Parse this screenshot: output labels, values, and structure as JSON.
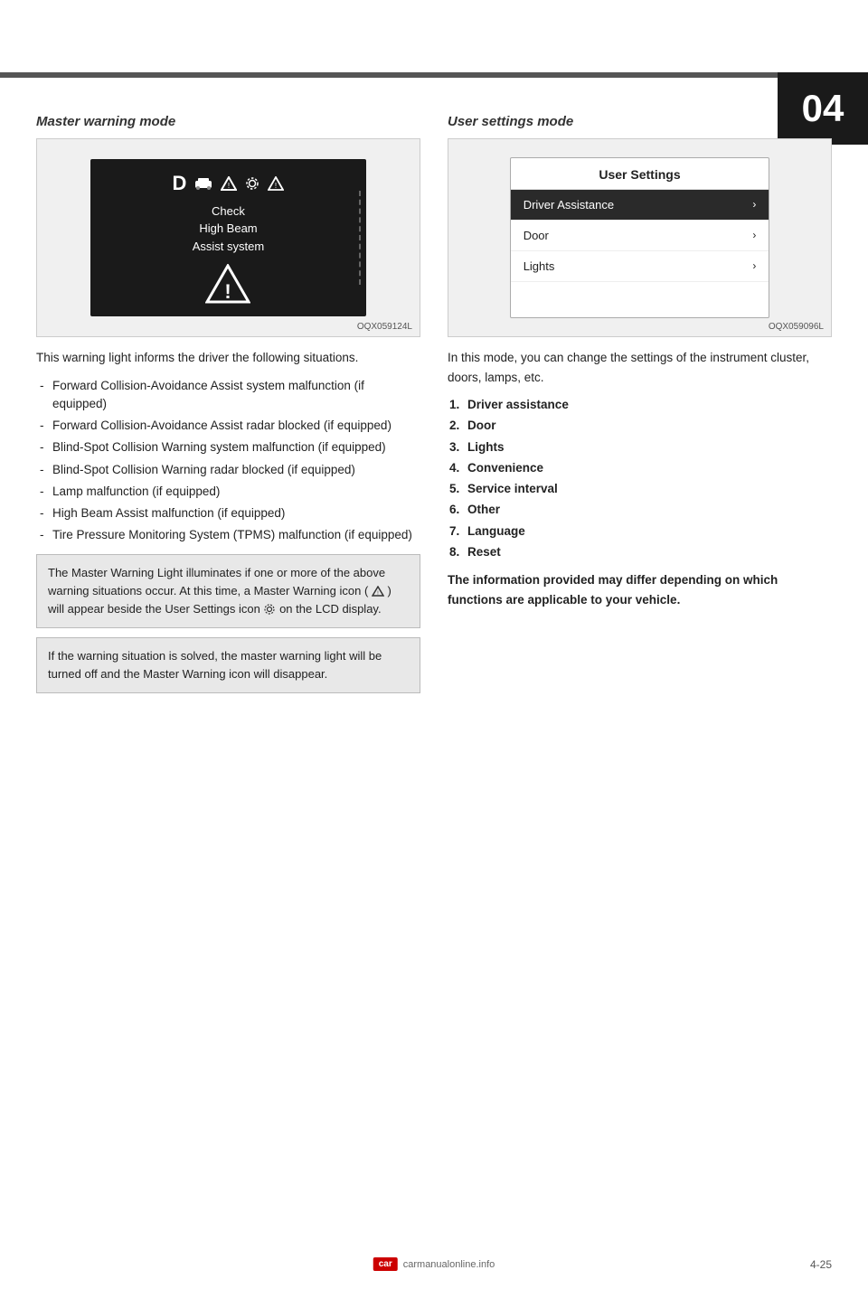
{
  "chapter": {
    "number": "04"
  },
  "left_section": {
    "heading": "Master warning mode",
    "image_label": "OQX059124L",
    "display": {
      "letter": "D",
      "warning_text_line1": "Check",
      "warning_text_line2": "High Beam",
      "warning_text_line3": "Assist system"
    },
    "intro_text": "This warning light informs the driver the following situations.",
    "bullets": [
      "Forward Collision-Avoidance Assist system malfunction (if equipped)",
      "Forward Collision-Avoidance Assist radar blocked (if equipped)",
      "Blind-Spot Collision Warning system malfunction (if equipped)",
      "Blind-Spot Collision Warning radar blocked (if equipped)",
      "Lamp malfunction (if equipped)",
      "High Beam Assist malfunction (if equipped)",
      "Tire Pressure Monitoring System (TPMS) malfunction (if equipped)"
    ],
    "info_box_text": "The Master Warning Light illuminates if one or more of the above warning situations occur. At this time, a Master Warning icon (⚠) will appear beside the User Settings icon ⚙ on the LCD display.",
    "info_box_text2": "If the warning situation is solved, the master warning light will be turned off and the Master Warning icon will disappear."
  },
  "right_section": {
    "heading": "User settings mode",
    "image_label": "OQX059096L",
    "display": {
      "title": "User Settings",
      "menu_items": [
        {
          "label": "Driver Assistance",
          "selected": true,
          "arrow": "›"
        },
        {
          "label": "Door",
          "selected": false,
          "arrow": "›"
        },
        {
          "label": "Lights",
          "selected": false,
          "arrow": "›"
        }
      ]
    },
    "intro_text": "In this mode, you can change the settings of the instrument cluster, doors, lamps, etc.",
    "numbered_items": [
      "Driver assistance",
      "Door",
      "Lights",
      "Convenience",
      "Service interval",
      "Other",
      "Language",
      "Reset"
    ],
    "note_text": "The information provided may differ depending on which functions are applicable to your vehicle."
  },
  "page_number": "4-25",
  "watermark": {
    "logo": "car",
    "text": "carmanualonline.info"
  }
}
